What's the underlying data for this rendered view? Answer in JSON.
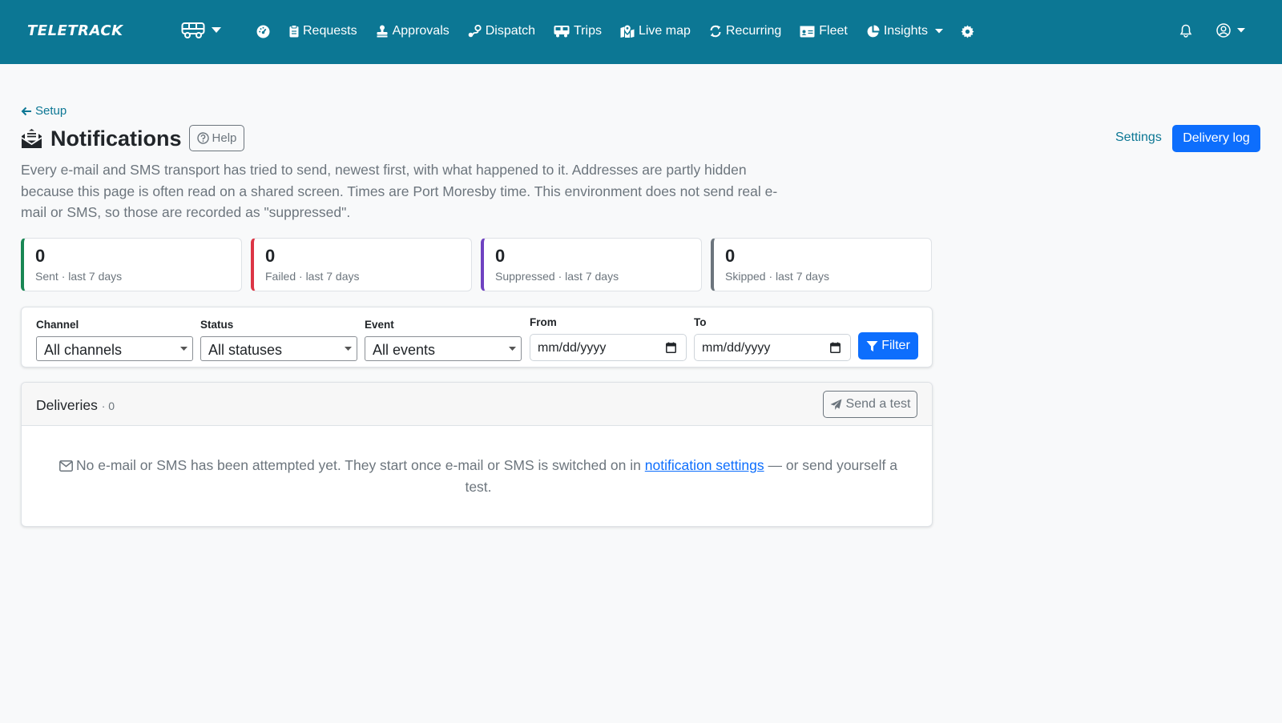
{
  "colors": {
    "navbar": "#0c7794",
    "link": "#0c7794",
    "primary": "#0d6efd",
    "muted": "#6c757d",
    "sent": "#198754",
    "failed": "#dc3545",
    "suppressed": "#6f42c1",
    "skipped": "#6c757d"
  },
  "navbar": {
    "brand": "TELETRACK",
    "vehicle_switch_icon": "bus-icon",
    "items": [
      {
        "label": "",
        "icon": "dashboard-icon"
      },
      {
        "label": "Requests",
        "icon": "clipboard-icon"
      },
      {
        "label": "Approvals",
        "icon": "stamp-icon"
      },
      {
        "label": "Dispatch",
        "icon": "route-icon"
      },
      {
        "label": "Trips",
        "icon": "bus-icon"
      },
      {
        "label": "Live map",
        "icon": "map-location-icon"
      },
      {
        "label": "Recurring",
        "icon": "repeat-icon"
      },
      {
        "label": "Fleet",
        "icon": "id-card-icon"
      },
      {
        "label": "Insights",
        "icon": "pie-chart-icon",
        "dropdown": true
      },
      {
        "label": "",
        "icon": "gear-icon"
      }
    ],
    "right": {
      "bell_icon": "bell-icon",
      "user_icon": "user-circle-icon"
    }
  },
  "back_link": "Setup",
  "page": {
    "title": "Notifications",
    "help_label": "Help",
    "settings_label": "Settings",
    "delivery_log_label": "Delivery log",
    "description": "Every e-mail and SMS transport has tried to send, newest first, with what happened to it. Addresses are partly hidden because this page is often read on a shared screen. Times are Port Moresby time. This environment does not send real e-mail or SMS, so those are recorded as \"suppressed\"."
  },
  "stats": [
    {
      "value": "0",
      "label": "Sent · last 7 days"
    },
    {
      "value": "0",
      "label": "Failed · last 7 days"
    },
    {
      "value": "0",
      "label": "Suppressed · last 7 days"
    },
    {
      "value": "0",
      "label": "Skipped · last 7 days"
    }
  ],
  "filters": {
    "channel": {
      "label": "Channel",
      "value": "All channels"
    },
    "status": {
      "label": "Status",
      "value": "All statuses"
    },
    "event": {
      "label": "Event",
      "value": "All events"
    },
    "from": {
      "label": "From",
      "value": "mm/dd/yyyy"
    },
    "to": {
      "label": "To",
      "value": "mm/dd/yyyy"
    },
    "button": "Filter"
  },
  "deliveries": {
    "title": "Deliveries",
    "count": "· 0",
    "send_test_label": "Send a test",
    "empty_before": "No e-mail or SMS has been attempted yet. They start once e-mail or SMS is switched on in",
    "empty_link": "notification settings",
    "empty_after": "— or send yourself a test."
  }
}
